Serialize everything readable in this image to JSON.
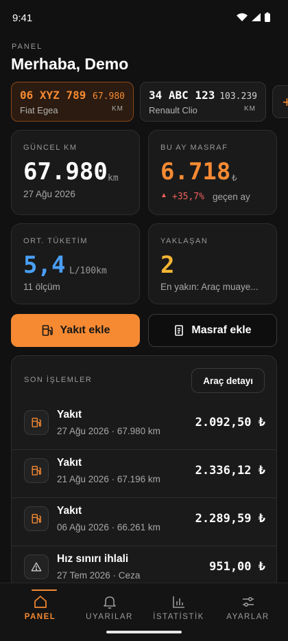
{
  "status_bar": {
    "time": "9:41"
  },
  "header": {
    "section": "PANEL",
    "greeting": "Merhaba, Demo"
  },
  "vehicles": [
    {
      "plate": "06 XYZ 789",
      "model": "Fiat Egea",
      "km": "67.980",
      "km_unit": "KM",
      "active": true
    },
    {
      "plate": "34 ABC 123",
      "model": "Renault Clio",
      "km": "103.239",
      "km_unit": "KM",
      "active": false
    }
  ],
  "add_vehicle": {
    "label": "+"
  },
  "stats": {
    "current_km": {
      "label": "GÜNCEL KM",
      "value": "67.980",
      "unit": "km",
      "sub": "27 Ağu 2026"
    },
    "monthly_expense": {
      "label": "BU AY MASRAF",
      "value": "6.718",
      "unit": "₺",
      "change": "+35,7%",
      "change_text": "geçen ay"
    },
    "avg_consumption": {
      "label": "ORT. TÜKETİM",
      "value": "5,4",
      "unit": "L/100km",
      "sub": "11 ölçüm"
    },
    "upcoming": {
      "label": "YAKLAŞAN",
      "value": "2",
      "sub": "En yakın: Araç muaye..."
    }
  },
  "actions": {
    "add_fuel": "Yakıt ekle",
    "add_expense": "Masraf ekle"
  },
  "transactions": {
    "title": "SON İŞLEMLER",
    "detail_button": "Araç detayı",
    "items": [
      {
        "name": "Yakıt",
        "meta": "27 Ağu 2026 · 67.980 km",
        "amount": "2.092,50 ₺",
        "icon": "fuel-pump-icon"
      },
      {
        "name": "Yakıt",
        "meta": "21 Ağu 2026 · 67.196 km",
        "amount": "2.336,12 ₺",
        "icon": "fuel-pump-icon"
      },
      {
        "name": "Yakıt",
        "meta": "06 Ağu 2026 · 66.261 km",
        "amount": "2.289,59 ₺",
        "icon": "fuel-pump-icon"
      },
      {
        "name": "Hız sınırı ihlali",
        "meta": "27 Tem 2026 · Ceza",
        "amount": "951,00 ₺",
        "icon": "warning-triangle-icon"
      }
    ]
  },
  "nav": [
    {
      "label": "PANEL",
      "icon": "home-icon",
      "active": true
    },
    {
      "label": "UYARILAR",
      "icon": "bell-icon",
      "active": false
    },
    {
      "label": "İSTATİSTİK",
      "icon": "bar-chart-icon",
      "active": false
    },
    {
      "label": "AYARLAR",
      "icon": "sliders-icon",
      "active": false
    }
  ],
  "colors": {
    "accent": "#f58a33",
    "blue": "#4a9ff5",
    "yellow": "#f5b533",
    "negative": "#f0605a"
  }
}
